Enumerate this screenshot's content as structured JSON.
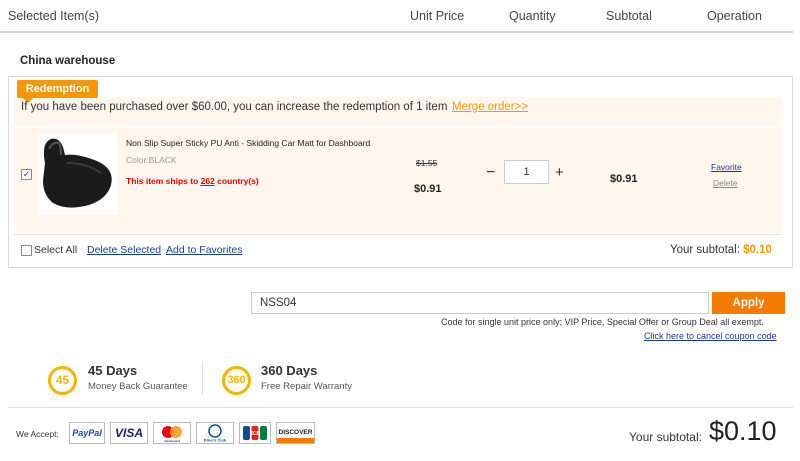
{
  "header": {
    "col_item": "Selected Item(s)",
    "col_unit_price": "Unit Price",
    "col_quantity": "Quantity",
    "col_subtotal": "Subtotal",
    "col_operation": "Operation"
  },
  "warehouse": {
    "title": "China warehouse",
    "redemption_badge": "Redemption",
    "redemption_text": "If you have been purchased over $60.00, you can increase the redemption of 1 item",
    "merge_link": "Merge order>>"
  },
  "item": {
    "name": "Non Slip Super Sticky PU Anti - Skidding Car Matt for Dashboard",
    "color": "Color:BLACK",
    "ship_prefix": "This item ships to ",
    "ship_count": "262",
    "ship_suffix": " country(s)",
    "old_price": "$1.55",
    "price": "$0.91",
    "quantity": "1",
    "qty_minus": "−",
    "qty_plus": "+",
    "subtotal": "$0.91",
    "favorite": "Favorite",
    "delete": "Delete",
    "checked": true
  },
  "box_footer": {
    "select_all": "Select All",
    "delete_selected": "Delete Selected",
    "add_favorites": "Add to Favorites",
    "subtotal_label": "Your subtotal: ",
    "subtotal_value": "$0.10"
  },
  "coupon": {
    "value": "NSS04",
    "apply": "Apply",
    "note": "Code for single unit price only; VIP Price, Special Offer or Group Deal all exempt.",
    "cancel": "Click here to cancel coupon code"
  },
  "guarantees": [
    {
      "badge": "45",
      "title": "45 Days",
      "subtitle": "Money Back Guarantee"
    },
    {
      "badge": "360",
      "title": "360 Days",
      "subtitle": "Free Repair Warranty"
    }
  ],
  "payment": {
    "we_accept": "We Accept:",
    "methods": [
      "PayPal",
      "VISA",
      "mastercard",
      "Diners Club",
      "JCB",
      "DISCOVER"
    ]
  },
  "grand_total": {
    "label": "Your subtotal:",
    "value": "$0.10"
  },
  "colors": {
    "accent": "#f39800",
    "apply_button": "#f47b00",
    "link": "#1a3d8f",
    "ship_text": "#ee0000",
    "guarantee": "#f5b400"
  }
}
